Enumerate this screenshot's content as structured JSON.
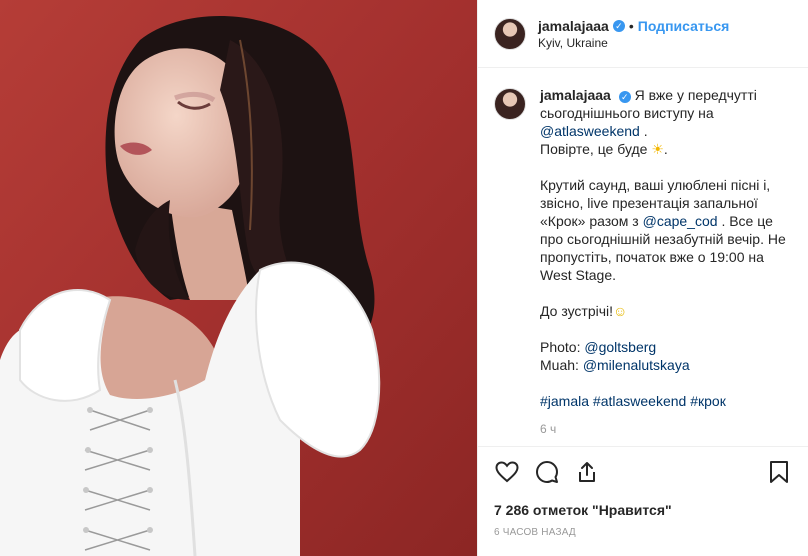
{
  "header": {
    "username": "jamalajaaa",
    "separator": "•",
    "follow_label": "Подписаться",
    "location": "Kyiv, Ukraine"
  },
  "caption": {
    "username": "jamalajaaa",
    "line1": "Я вже у передчутті сьогоднішнього виступу на",
    "mention_atlas": "@atlasweekend",
    "after_atlas": ".",
    "line2_before": "Повірте, це буде",
    "sun_emoji": "☀",
    "line2_after": ".",
    "para2_before": "Крутий саунд, ваші улюблені пісні і, звісно, live презентація запальної «Крок» разом з",
    "mention_cape": "@cape_cod",
    "para2_after": ". Все це про сьогоднішній незабутній вечір. Не пропустіть, початок вже о 19:00 на West Stage.",
    "para3": "До зустрічі!",
    "smile_emoji": "☺",
    "photo_label": "Photo:",
    "photo_mention": "@goltsberg",
    "muah_label": "Muah:",
    "muah_mention": "@milenalutskaya",
    "tag1": "#jamala",
    "tag2": "#atlasweekend",
    "tag3": "#крок",
    "time_short": "6 ч"
  },
  "actions": {
    "like_icon": "heart-icon",
    "comment_icon": "comment-icon",
    "share_icon": "share-icon",
    "save_icon": "bookmark-icon",
    "likes_text": "7 286 отметок \"Нравится\"",
    "posted_ago": "6 часов назад"
  },
  "colors": {
    "accent": "#3897f0",
    "link": "#003569",
    "photo_background": "#a83431"
  }
}
